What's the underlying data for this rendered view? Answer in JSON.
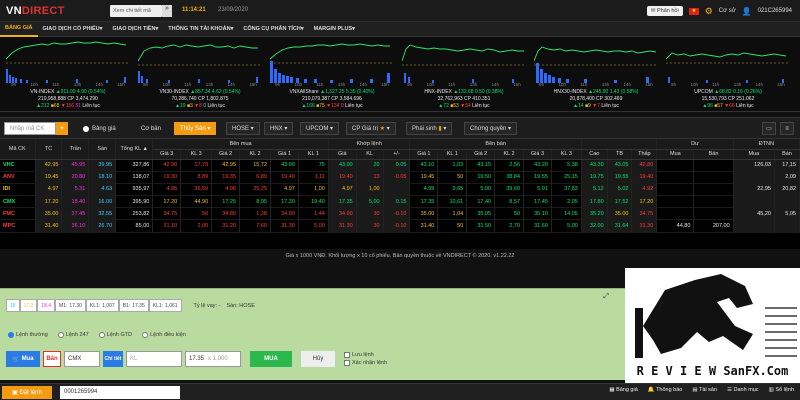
{
  "topbar": {
    "logo_a": "VN",
    "logo_b": "DIRECT",
    "quote_placeholder": "Xem chi tiết mã",
    "quote_btn": "»",
    "time": "11:14:21",
    "date": "23/09/2020",
    "notify": "Phản hồi",
    "level": "Cơ sở",
    "account": "021C265994"
  },
  "nav": [
    "BẢNG GIÁ",
    "GIAO DỊCH CỔ PHIẾU",
    "GIAO DỊCH TIỀN",
    "THÔNG TIN TÀI KHOẢN",
    "CÔNG CỤ PHÂN TÍCH",
    "MARGIN PLUS"
  ],
  "indices": [
    {
      "name": "VN-INDEX",
      "value": "911.09",
      "chg": "4.90 (0.54%)",
      "vol": "210,958,888",
      "cp": "3,474.290",
      "up": "212",
      "ref": "68",
      "dn": "156",
      "ceil": "51",
      "floor": "",
      "status": "Liên tục",
      "axis": [
        "9h",
        "10h",
        "11h",
        "13h",
        "14h",
        "15h"
      ]
    },
    {
      "name": "VN30-INDEX",
      "value": "857.34",
      "chg": "4.62 (0.54%)",
      "vol": "70,286,740",
      "cp": "1,802.875",
      "up": "19",
      "ref": "3",
      "dn": "8",
      "ceil": "",
      "floor": "0",
      "status": "Liên tục",
      "axis": [
        "9h",
        "10h",
        "11h",
        "13h",
        "14h",
        "15h"
      ]
    },
    {
      "name": "VNXAllShare",
      "value": "1,327.25",
      "chg": "5.35 (0.40%)",
      "vol": "210,079,387",
      "cp": "3,584.696",
      "up": "166",
      "ref": "75",
      "dn": "134",
      "ceil": "0",
      "floor": "",
      "status": "Liên tục",
      "axis": [
        "9h",
        "10h",
        "11h",
        "13h",
        "14h",
        "15h"
      ]
    },
    {
      "name": "HNX-INDEX",
      "value": "132.68",
      "chg": "0.50 (0.38%)",
      "vol": "32,762,963",
      "cp": "410.351",
      "up": "72",
      "ref": "53",
      "dn": "54",
      "ceil": "",
      "floor": "",
      "status": "Liên tục",
      "axis": [
        "9h",
        "10h",
        "11h",
        "13h",
        "14h",
        "15h"
      ]
    },
    {
      "name": "HNX30-INDEX",
      "value": "245.90",
      "chg": "1.43 (0.58%)",
      "vol": "20,878,400",
      "cp": "302.469",
      "up": "14",
      "ref": "9",
      "dn": "7",
      "ceil": "",
      "floor": "",
      "status": "Liên tục",
      "axis": [
        "9h",
        "10h",
        "11h",
        "13h",
        "14h",
        "15h"
      ]
    },
    {
      "name": "UPCOM",
      "value": "68.82",
      "chg": "0.16 (0.26%)",
      "vol": "15,530,793",
      "cp": "251.062",
      "up": "96",
      "ref": "57",
      "dn": "66",
      "ceil": "",
      "floor": "",
      "status": "Liên tục",
      "axis": [
        "9h",
        "10h",
        "11h",
        "13h",
        "14h",
        "15h"
      ]
    }
  ],
  "toolbar": {
    "search_placeholder": "Nhập mã CK",
    "add": "+",
    "tab_bang_gia": "Bảng giá",
    "tab_co_ban": "Cơ bản",
    "tab_thuy_san": "Thủy Sản",
    "hose": "HOSE",
    "hnx": "HNX",
    "upcom": "UPCOM",
    "cp_gia_tri": "CP Giá trị",
    "phai_sinh": "Phái sinh",
    "chung_quyen": "Chứng quyền"
  },
  "grid": {
    "group_headers": [
      "Mã CK",
      "TC",
      "Trần",
      "Sàn",
      "Tổng KL",
      "Bên mua",
      "Khớp lệnh",
      "Bên bán",
      "Dư",
      "ĐTNN"
    ],
    "sub_headers": [
      "Giá 3",
      "KL 3",
      "Giá 2",
      "KL 2",
      "Giá 1",
      "KL 1",
      "Giá",
      "KL",
      "+/-",
      "Giá 1",
      "KL 1",
      "Giá 2",
      "KL 2",
      "Giá 3",
      "KL 3",
      "Cao",
      "TB",
      "Thấp",
      "Mua",
      "Bán",
      "Mua",
      "Bán"
    ],
    "rows": [
      {
        "sym": "VHC",
        "tc": "42.95",
        "tran": "45.95",
        "san": "39.95",
        "tkl": "327,86",
        "b3": "42.90",
        "bk3": "17,79",
        "b2": "42.95",
        "bk2": "15,72",
        "b1": "43.00",
        "bk1": "75",
        "mp": "43.00",
        "mk": "20",
        "mc": "0.05",
        "s1": "43.10",
        "sk1": "1,03",
        "s2": "43.15",
        "sk2": "2,56",
        "s3": "43.20",
        "sk3": "5,38",
        "hi": "43.30",
        "av": "43.05",
        "lo": "42.80",
        "dm": "",
        "db": "",
        "fm": "126,03",
        "fb": "17,15"
      },
      {
        "sym": "ANV",
        "tc": "19.45",
        "tran": "20.80",
        "san": "18.10",
        "tkl": "138,07",
        "b3": "19.30",
        "bk3": "8,89",
        "b2": "19.35",
        "bk2": "6,89",
        "b1": "19.40",
        "bk1": "1,11",
        "mp": "19.40",
        "mk": "13",
        "mc": "-0.05",
        "s1": "19.45",
        "sk1": "50",
        "s2": "19.50",
        "sk2": "38,84",
        "s3": "19.55",
        "sk3": "25,15",
        "hi": "19.75",
        "av": "19.55",
        "lo": "19.40",
        "dm": "",
        "db": "",
        "fm": "",
        "fb": "2,09"
      },
      {
        "sym": "IDI",
        "tc": "4.97",
        "tran": "5.31",
        "san": "4.63",
        "tkl": "935,97",
        "b3": "4.95",
        "bk3": "36,59",
        "b2": "4.96",
        "bk2": "25,25",
        "b1": "4.97",
        "bk1": "1,00",
        "mp": "4.97",
        "mk": "1,00",
        "mc": "",
        "s1": "4.99",
        "sk1": "9,65",
        "s2": "5.00",
        "sk2": "39,60",
        "s3": "5.01",
        "sk3": "37,83",
        "hi": "5.12",
        "av": "5.02",
        "lo": "4.92",
        "dm": "",
        "db": "",
        "fm": "22,95",
        "fb": "20,82"
      },
      {
        "sym": "CMX",
        "tc": "17.20",
        "tran": "18.40",
        "san": "16.00",
        "tkl": "395,90",
        "b3": "17.20",
        "bk3": "44,90",
        "b2": "17.25",
        "bk2": "8,95",
        "b1": "17.30",
        "bk1": "19,40",
        "mp": "17.35",
        "mk": "5,00",
        "mc": "0.15",
        "s1": "17.35",
        "sk1": "10,61",
        "s2": "17.40",
        "sk2": "8,57",
        "s3": "17.45",
        "sk3": "2,05",
        "hi": "17.80",
        "av": "17.52",
        "lo": "17.20",
        "dm": "",
        "db": "",
        "fm": "",
        "fb": ""
      },
      {
        "sym": "FMC",
        "tc": "35.00",
        "tran": "37.45",
        "san": "32.55",
        "tkl": "253,82",
        "b3": "34.75",
        "bk3": "50",
        "b2": "34.80",
        "bk2": "1,28",
        "b1": "34.90",
        "bk1": "1,44",
        "mp": "34.90",
        "mk": "30",
        "mc": "-0.10",
        "s1": "35.00",
        "sk1": "1,04",
        "s2": "35.05",
        "sk2": "50",
        "s3": "35.10",
        "sk3": "14,05",
        "hi": "35.20",
        "av": "35.00",
        "lo": "34.75",
        "dm": "",
        "db": "",
        "fm": "45,20",
        "fb": "5,05"
      },
      {
        "sym": "MPC",
        "tc": "31.40",
        "tran": "36.10",
        "san": "26.70",
        "tkl": "85,00",
        "b3": "31.10",
        "bk3": "2,00",
        "b2": "31.20",
        "bk2": "7,60",
        "b1": "31.30",
        "bk1": "5,00",
        "mp": "31.30",
        "mk": "30",
        "mc": "-0.10",
        "s1": "31.40",
        "sk1": "50",
        "s2": "31.50",
        "sk2": "2,70",
        "s3": "31.60",
        "sk3": "5,00",
        "hi": "32.00",
        "av": "31.64",
        "lo": "31.30",
        "dm": "44,80",
        "db": "207,00",
        "fm": "",
        "fb": ""
      }
    ]
  },
  "footnote": "Giá x 1000 VNĐ. Khối lượng x 10 cổ phiếu. Bản quyền thuộc về VNDIRECT © 2020. v1.22.22",
  "order": {
    "strip": [
      {
        "l": "18",
        "v": ""
      },
      {
        "l": "17.2",
        "v": ""
      },
      {
        "l": "18.4",
        "v": ""
      },
      {
        "l": "M1:",
        "v": "17.30"
      },
      {
        "l": "KL1:",
        "v": "1,007"
      },
      {
        "l": "B1:",
        "v": "17.35"
      },
      {
        "l": "KL1:",
        "v": "1,061"
      }
    ],
    "ratio_label": "Tỷ lệ vay: -",
    "exchange_label": "Sàn: HOSE",
    "radios": [
      "Lệnh thường",
      "Lệnh 247",
      "Lệnh GTD",
      "Lệnh điều kiện"
    ],
    "buy_btn": "Mua",
    "sell_btn": "Bán",
    "symbol": "CMX",
    "detail": "Chi tiết",
    "qty_placeholder": "KL",
    "price": "17.35",
    "price_mult": "x 1,000",
    "submit": "MUA",
    "cancel": "Hủy",
    "save_order": "Lưu lệnh",
    "confirm": "Xác nhận lệnh"
  },
  "bottom": {
    "place_order": "Đặt lệnh",
    "account": "0001265994",
    "items": [
      "Bảng giá",
      "Thông báo",
      "Tài sản",
      "Danh mục",
      "Sổ lệnh"
    ]
  },
  "watermark": {
    "text_a": "R E V I E W ",
    "text_b": "SanFX.Com"
  }
}
